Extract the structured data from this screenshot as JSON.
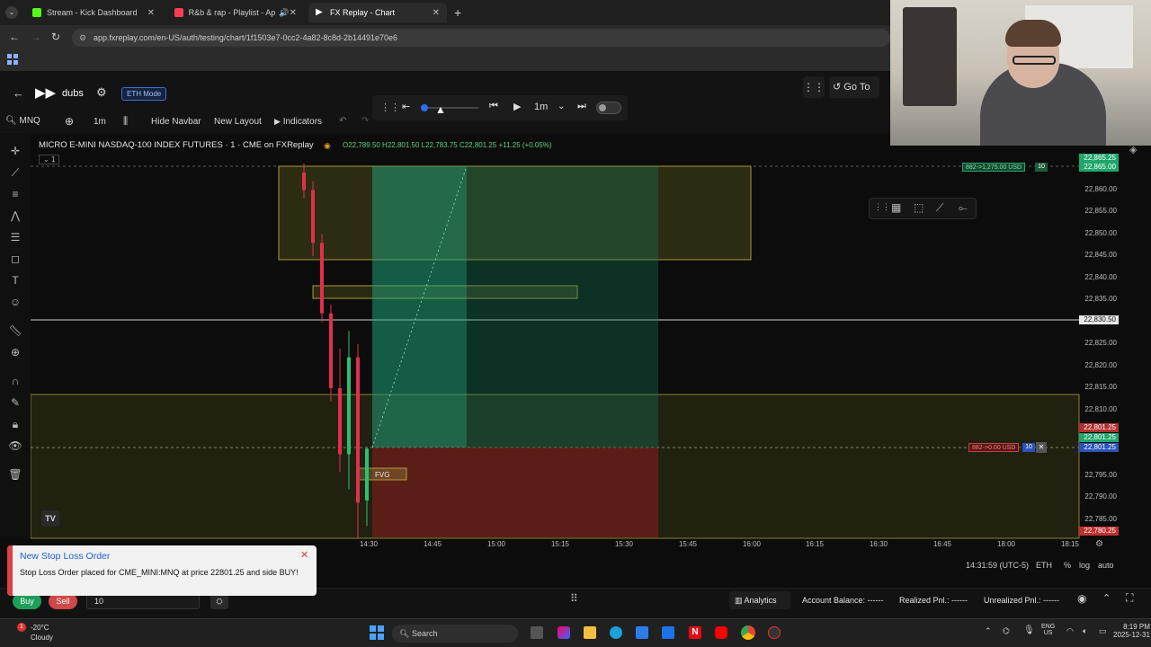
{
  "browser": {
    "tabs": [
      {
        "label": "Stream - Kick Dashboard",
        "favicon_color": "#53fc18"
      },
      {
        "label": "R&b & rap - Playlist - Apple",
        "favicon_color": "#fa3c56"
      },
      {
        "label": "FX Replay - Chart",
        "favicon_color": "#ffffff"
      }
    ],
    "url": "app.fxreplay.com/en-US/auth/testing/chart/1f1503e7-0cc2-4a82-8c8d-2b14491e70e6"
  },
  "app": {
    "workspace_name": "dubs",
    "eth_mode_label": "ETH Mode",
    "go_to_label": "Go To",
    "toolbar": {
      "symbol": "MNQ",
      "interval": "1m",
      "hide_navbar": "Hide Navbar",
      "new_layout": "New Layout",
      "indicators": "Indicators"
    },
    "replay": {
      "interval": "1m",
      "progress": 0.0
    }
  },
  "chart_data": {
    "type": "candlestick",
    "title": "MICRO E-MINI NASDAQ-100 INDEX FUTURES · 1 · CME on FXReplay",
    "ohlc": {
      "o": "O22,789.50",
      "h": "H22,801.50",
      "l": "L22,783.75",
      "c": "C22,801.25",
      "chg": "+11.25 (+0.05%)"
    },
    "pane_badge": "1",
    "price_ticks": [
      "22,860.00",
      "22,855.00",
      "22,850.00",
      "22,845.00",
      "22,840.00",
      "22,835.00",
      "22,825.00",
      "22,820.00",
      "22,815.00",
      "22,810.00",
      "22,795.00",
      "22,790.00",
      "22,785.00"
    ],
    "time_ticks": [
      "14:30",
      "14:45",
      "15:00",
      "15:15",
      "15:30",
      "15:45",
      "16:00",
      "16:15",
      "16:30",
      "16:45",
      "18:00",
      "18:15"
    ],
    "price_tags": {
      "top1": "22,865.25",
      "top2": "22,865.00",
      "current": "22,830.50",
      "entry1": "22,801.25",
      "entry2": "22,801.25",
      "entry3": "22,801.25",
      "bottom": "22,780.25"
    },
    "tp_label": "882->1,275.00 USD",
    "tp_qty": "10",
    "sl_label": "882->0.00 USD",
    "sl_qty": "10",
    "fvg_label": "FVG",
    "candles_approx": [
      {
        "t": "14:24",
        "o": 22864,
        "h": 22866,
        "l": 22858,
        "c": 22860
      },
      {
        "t": "14:25",
        "o": 22860,
        "h": 22862,
        "l": 22845,
        "c": 22848
      },
      {
        "t": "14:26",
        "o": 22848,
        "h": 22850,
        "l": 22830,
        "c": 22832
      },
      {
        "t": "14:27",
        "o": 22832,
        "h": 22834,
        "l": 22812,
        "c": 22815
      },
      {
        "t": "14:28",
        "o": 22815,
        "h": 22824,
        "l": 22796,
        "c": 22800
      },
      {
        "t": "14:29",
        "o": 22800,
        "h": 22828,
        "l": 22792,
        "c": 22822
      },
      {
        "t": "14:30",
        "o": 22822,
        "h": 22825,
        "l": 22781,
        "c": 22789
      },
      {
        "t": "14:31",
        "o": 22789.5,
        "h": 22801.5,
        "l": 22783.75,
        "c": 22801.25
      }
    ]
  },
  "status": {
    "time": "14:31:59 (UTC-5)",
    "session": "ETH",
    "percent": "%",
    "log": "log",
    "auto": "auto"
  },
  "toast": {
    "title": "New Stop Loss Order",
    "message": "Stop Loss Order placed for CME_MINI:MNQ at price 22801.25 and side BUY!"
  },
  "trade": {
    "buy": "Buy",
    "sell": "Sell",
    "qty": "10"
  },
  "bottom": {
    "analytics": "Analytics",
    "balance": "Account Balance: ------",
    "realized": "Realized Pnl.: ------",
    "unrealized": "Unrealized Pnl.: ------"
  },
  "taskbar": {
    "temp": "-20°C",
    "weather": "Cloudy",
    "search": "Search",
    "lang1": "ENG",
    "lang2": "US",
    "clock": "8:19 PM",
    "date": "2025-12-31"
  }
}
